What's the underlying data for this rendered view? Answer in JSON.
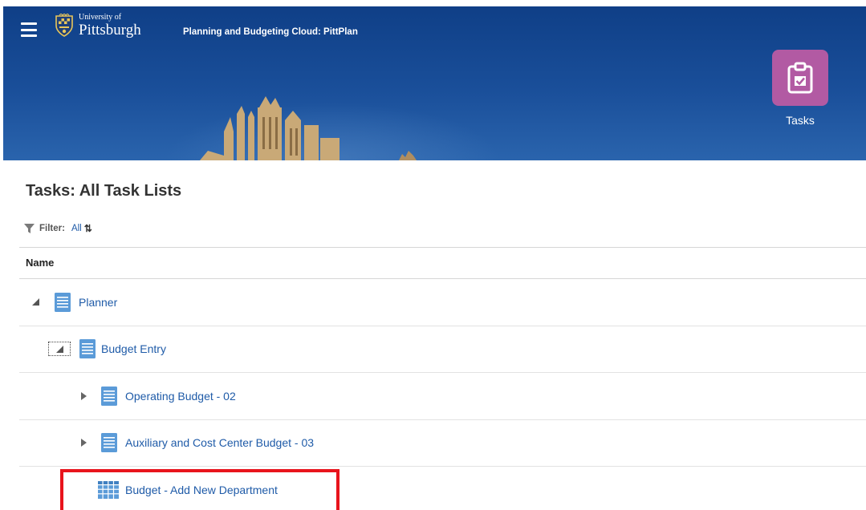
{
  "header": {
    "logo_line1": "University of",
    "logo_line2": "Pittsburgh",
    "app_title": "Planning and Budgeting Cloud: PittPlan",
    "tasks_tile_label": "Tasks"
  },
  "colors": {
    "banner_blue": "#1a4f9a",
    "tasks_tile": "#b25aa3",
    "link_blue": "#1f5ba8",
    "highlight_red": "#e8141c"
  },
  "page": {
    "title": "Tasks: All Task Lists",
    "filter_label": "Filter:",
    "filter_value": "All",
    "sort_glyph": "⇅"
  },
  "table": {
    "column_name": "Name",
    "rows": [
      {
        "label": "Planner",
        "icon": "task-list-icon",
        "expander": "expanded"
      },
      {
        "label": "Budget Entry",
        "icon": "task-list-icon",
        "expander": "expanded-focused"
      },
      {
        "label": "Operating Budget - 02",
        "icon": "task-list-icon",
        "expander": "collapsed"
      },
      {
        "label": "Auxiliary and Cost Center Budget - 03",
        "icon": "task-list-icon",
        "expander": "collapsed"
      },
      {
        "label": "Budget - Add New Department",
        "icon": "form-grid-icon",
        "expander": "none"
      }
    ]
  }
}
